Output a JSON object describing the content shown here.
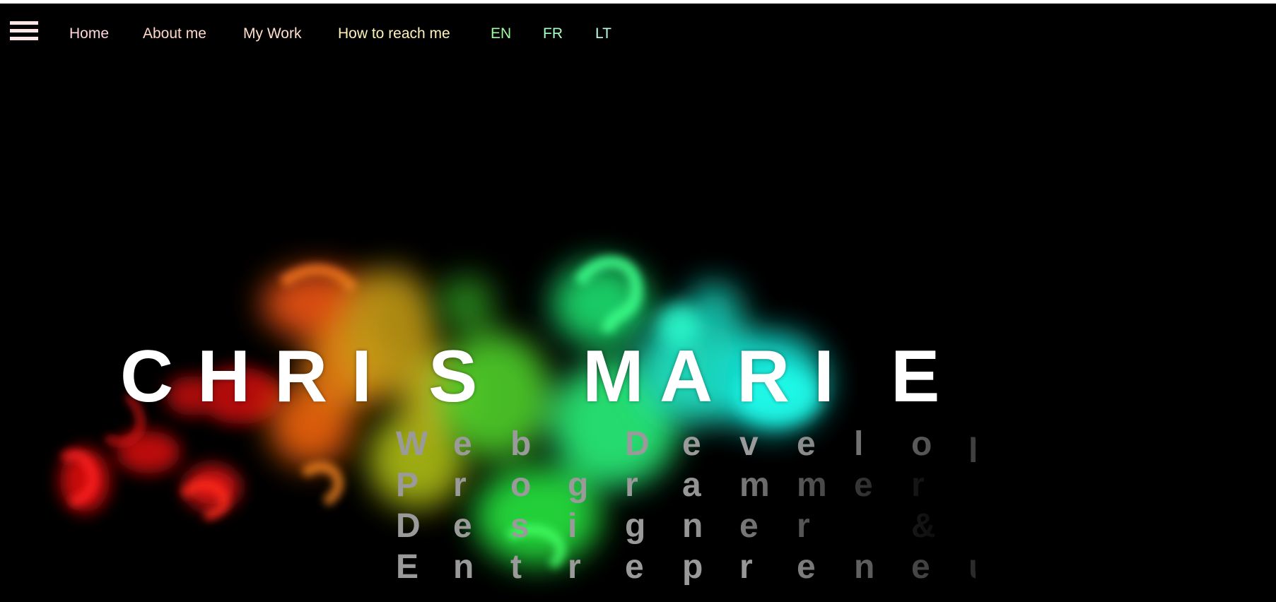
{
  "nav": {
    "menu_icon": "hamburger-menu-icon",
    "items": [
      {
        "label": "Home",
        "color": "#ffd6dc"
      },
      {
        "label": "About me",
        "color": "#ffd8c8"
      },
      {
        "label": "My Work",
        "color": "#ffe0cc"
      },
      {
        "label": "How to reach me",
        "color": "#fff2b8"
      },
      {
        "label": "EN",
        "color": "#9cff9c"
      },
      {
        "label": "FR",
        "color": "#a8ffc0"
      },
      {
        "label": "LT",
        "color": "#b8ffe6"
      }
    ]
  },
  "hero": {
    "name": "CHRIS MARIE",
    "roles": [
      "Web Developer",
      "Programmer",
      "Designer &",
      "Entrepreneur"
    ]
  },
  "colors": {
    "background": "#000000",
    "text": "#ffffff",
    "role_text": "#9a9a9a",
    "smoke_red": "#ff1a1a",
    "smoke_orange": "#ff7a1a",
    "smoke_green": "#33ff66",
    "smoke_cyan": "#22ffee"
  }
}
